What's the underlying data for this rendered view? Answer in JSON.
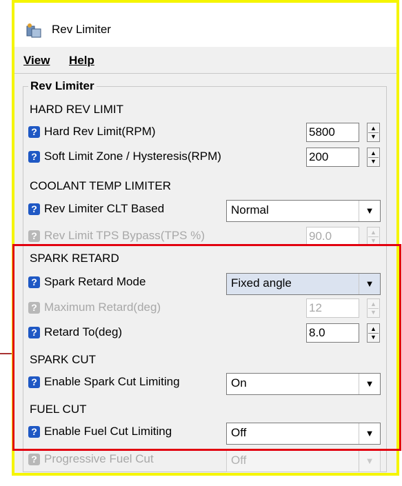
{
  "window": {
    "title": "Rev Limiter",
    "icon": "rev-limiter-app-icon"
  },
  "menu": {
    "view": "View",
    "help": "Help"
  },
  "group_title": "Rev Limiter",
  "sections": {
    "hard_rev": "HARD REV LIMIT",
    "coolant": "COOLANT TEMP LIMITER",
    "spark_retard": "SPARK RETARD",
    "spark_cut": "SPARK CUT",
    "fuel_cut": "FUEL CUT"
  },
  "fields": {
    "hard_rev_limit": {
      "label": "Hard Rev Limit(RPM)",
      "value": "5800",
      "enabled": true
    },
    "soft_limit_zone": {
      "label": "Soft Limit Zone / Hysteresis(RPM)",
      "value": "200",
      "enabled": true
    },
    "clt_based": {
      "label": "Rev Limiter CLT Based",
      "value": "Normal",
      "enabled": true
    },
    "tps_bypass": {
      "label": "Rev Limit TPS Bypass(TPS %)",
      "value": "90.0",
      "enabled": false
    },
    "spark_retard_mode": {
      "label": "Spark Retard Mode",
      "value": "Fixed angle",
      "enabled": true
    },
    "max_retard": {
      "label": "Maximum Retard(deg)",
      "value": "12",
      "enabled": false
    },
    "retard_to": {
      "label": "Retard To(deg)",
      "value": "8.0",
      "enabled": true
    },
    "spark_cut_enable": {
      "label": "Enable Spark Cut Limiting",
      "value": "On",
      "enabled": true
    },
    "fuel_cut_enable": {
      "label": "Enable Fuel Cut Limiting",
      "value": "Off",
      "enabled": true
    },
    "progressive_fuel_cut": {
      "label": "Progressive Fuel Cut",
      "value": "Off",
      "enabled": false
    }
  },
  "glyphs": {
    "help": "?",
    "spin_up": "▲",
    "spin_down": "▼",
    "dropdown": "▼"
  },
  "colors": {
    "highlight_border": "#e2000f",
    "window_border": "#f5f500",
    "help_icon": "#1f58c4"
  }
}
